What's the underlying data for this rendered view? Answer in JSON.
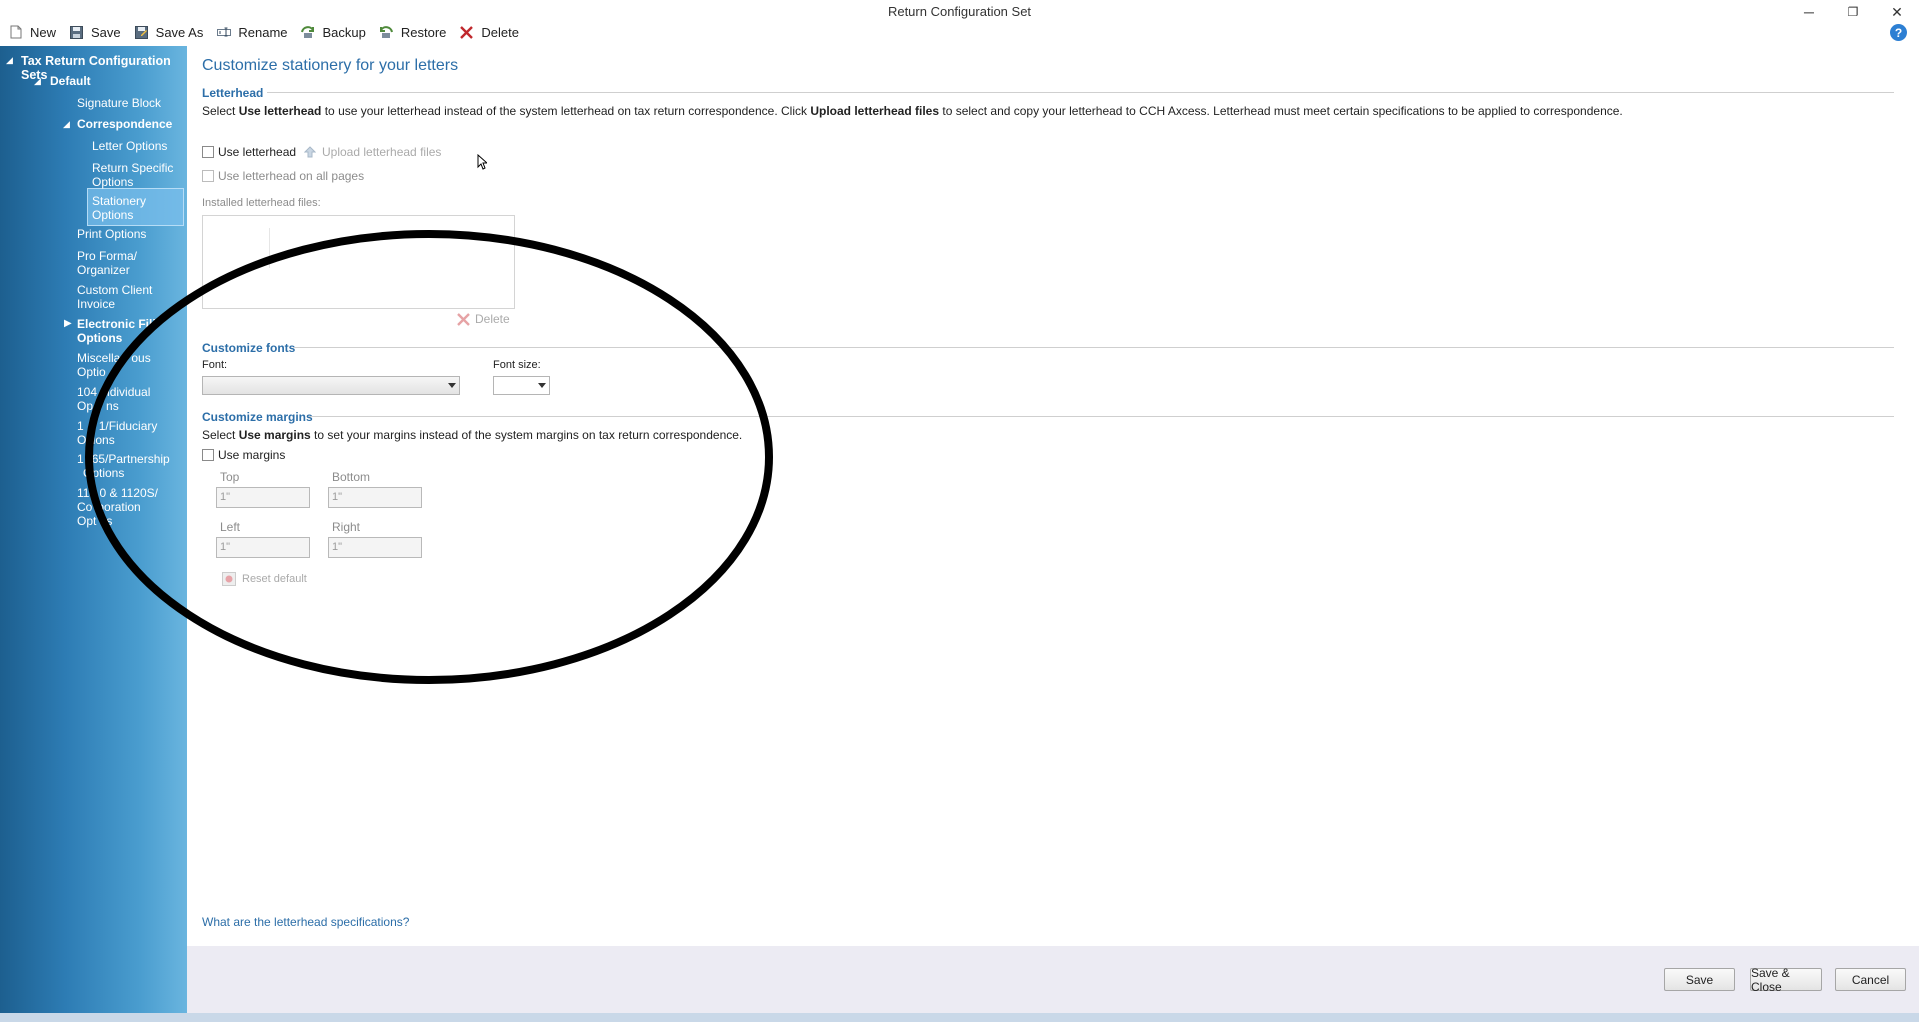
{
  "window": {
    "title": "Return Configuration Set",
    "minimize": "─",
    "restore": "❐",
    "close": "✕"
  },
  "toolbar": {
    "new": "New",
    "save": "Save",
    "save_as": "Save As",
    "rename": "Rename",
    "backup": "Backup",
    "restore": "Restore",
    "delete": "Delete",
    "help": "?"
  },
  "sidebar": {
    "root": "Tax Return Configuration Sets",
    "default": "Default",
    "signature_block": "Signature Block",
    "correspondence": "Correspondence",
    "letter_options": "Letter Options",
    "return_specific_1": "Return Specific",
    "return_specific_2": "Options",
    "stationery_1": "Stationery",
    "stationery_2": "Options",
    "print_options": "Print Options",
    "pro_forma_1": "Pro Forma/",
    "pro_forma_2": "Organizer",
    "custom_invoice_1": "Custom Client",
    "custom_invoice_2": "Invoice",
    "electronic_1": "Electronic Fili",
    "electronic_2": "Options",
    "misc_1": "Miscella",
    "misc_1b": "ous",
    "misc_2": "Optio",
    "ind_1": "104",
    "ind_1b": "ndividual",
    "ind_2": "Op",
    "ind_2b": "ns",
    "fid_1": "1",
    "fid_1b": "1/Fiduciary",
    "fid_2": "O",
    "fid_2b": "tions",
    "part_1": "1",
    "part_1b": "65/Partnership",
    "part_2": "Options",
    "corp_1": "11",
    "corp_1b": "0 & 1120S/",
    "corp_2": "Co",
    "corp_2b": "poration",
    "corp_3": "Opt",
    "corp_3b": "s"
  },
  "main": {
    "heading": "Customize stationery for your letters",
    "letterhead": {
      "section_title": "Letterhead",
      "desc_1": "Select ",
      "desc_b1": "Use letterhead",
      "desc_2": " to use your letterhead instead of the system letterhead on tax return correspondence. Click ",
      "desc_b2": "Upload letterhead files",
      "desc_3": " to select and copy your letterhead to CCH Axcess. Letterhead must meet certain specifications to be applied to correspondence.",
      "use_letterhead": "Use letterhead",
      "upload": "Upload letterhead files",
      "all_pages": "Use letterhead on all pages",
      "installed_label": "Installed letterhead files:",
      "delete": "Delete"
    },
    "fonts": {
      "section_title": "Customize fonts",
      "font_label": "Font:",
      "font_value": "",
      "size_label": "Font size:",
      "size_value": ""
    },
    "margins": {
      "section_title": "Customize margins",
      "desc_1": "Select ",
      "desc_b": "Use margins",
      "desc_2": " to set your margins instead of the system margins on tax return correspondence.",
      "use_margins": "Use margins",
      "top_label": "Top",
      "top_value": "1\"",
      "bottom_label": "Bottom",
      "bottom_value": "1\"",
      "left_label": "Left",
      "left_value": "1\"",
      "right_label": "Right",
      "right_value": "1\"",
      "reset": "Reset default"
    },
    "spec_link": "What are the letterhead specifications?"
  },
  "footer": {
    "save": "Save",
    "save_close": "Save & Close",
    "cancel": "Cancel"
  },
  "colors": {
    "accent": "#2c6ea8",
    "sidebar": "#2d7cb4",
    "footer": "#ecebf3"
  }
}
